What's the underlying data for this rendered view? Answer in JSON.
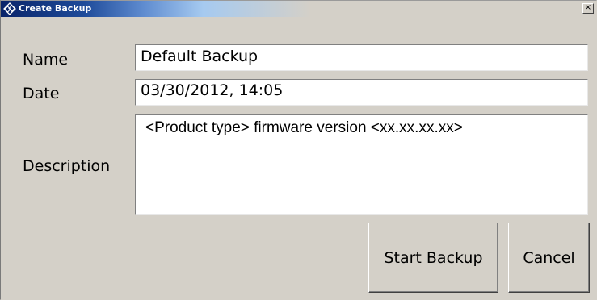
{
  "window": {
    "title": "Create Backup",
    "close_glyph": "×"
  },
  "form": {
    "name_label": "Name",
    "name_value": "Default Backup",
    "date_label": "Date",
    "date_value": "03/30/2012, 14:05",
    "description_label": "Description",
    "description_value": "<Product type> firmware version <xx.xx.xx.xx>"
  },
  "buttons": {
    "start_label": "Start Backup",
    "cancel_label": "Cancel"
  },
  "icons": {
    "app": "rohde-schwarz-diamond-icon",
    "close": "close-icon"
  },
  "colors": {
    "titlebar_start": "#0a246a",
    "titlebar_end": "#d4d0c8",
    "dialog_background": "#d4d0c8"
  }
}
